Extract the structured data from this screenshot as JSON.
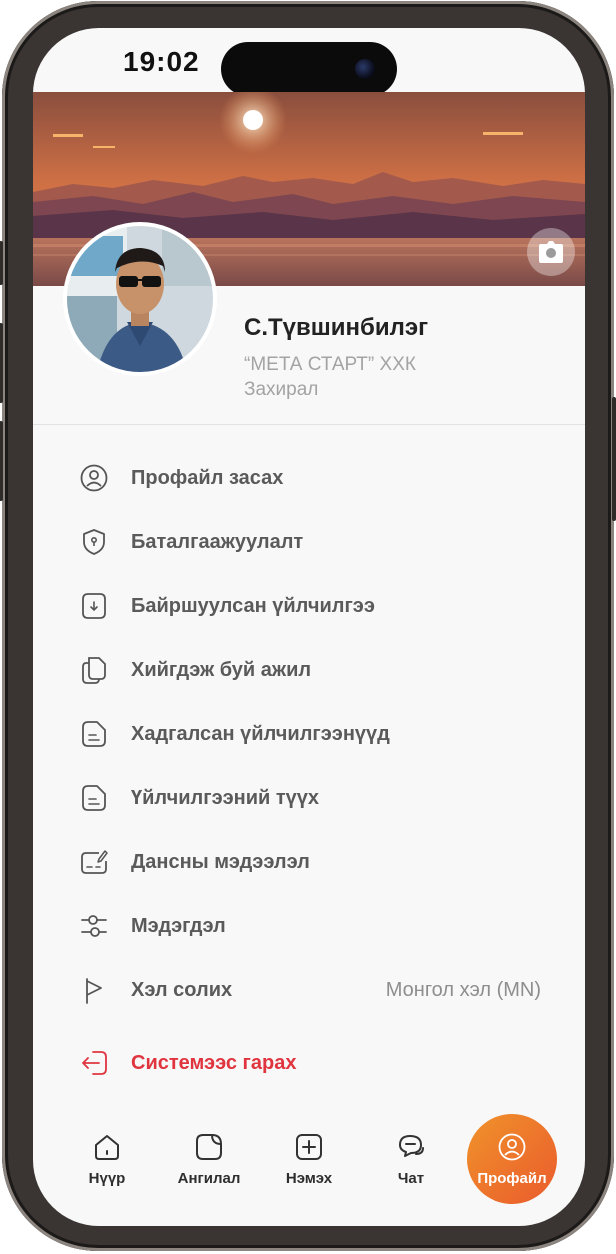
{
  "status_bar": {
    "time": "19:02"
  },
  "profile": {
    "name": "С.Түвшинбилэг",
    "company": "“МЕТА СТАРТ” ХХК",
    "role": "Захирал"
  },
  "menu": {
    "items": [
      {
        "label": "Профайл засах",
        "icon": "user-circle-icon"
      },
      {
        "label": "Баталгаажуулалт",
        "icon": "shield-icon"
      },
      {
        "label": "Байршуулсан үйлчилгээ",
        "icon": "file-download-icon"
      },
      {
        "label": "Хийгдэж буй ажил",
        "icon": "files-icon"
      },
      {
        "label": "Хадгалсан үйлчилгээнүүд",
        "icon": "document-icon"
      },
      {
        "label": "Үйлчилгээний түүх",
        "icon": "document-icon"
      },
      {
        "label": "Дансны мэдээлэл",
        "icon": "card-edit-icon"
      },
      {
        "label": "Мэдэгдэл",
        "icon": "sliders-icon"
      },
      {
        "label": "Хэл солих",
        "icon": "flag-icon",
        "value": "Монгол хэл (MN)"
      }
    ],
    "logout_label": "Системээс гарах"
  },
  "tabbar": {
    "home": "Нүүр",
    "category": "Ангилал",
    "add": "Нэмэх",
    "chat": "Чат",
    "profile": "Профайл"
  },
  "colors": {
    "accent_gradient_start": "#f0932b",
    "accent_gradient_end": "#ea5a2c",
    "logout_red": "#e0353f"
  }
}
